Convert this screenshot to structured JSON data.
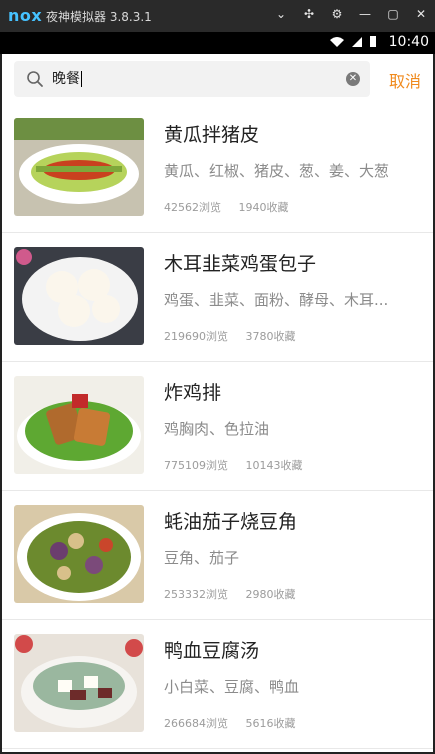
{
  "emulator": {
    "logo": "nox",
    "title": "夜神模拟器 3.8.3.1"
  },
  "status": {
    "time": "10:40"
  },
  "search": {
    "value": "晚餐",
    "cancel_label": "取消"
  },
  "recipes": [
    {
      "title": "黄瓜拌猪皮",
      "ingredients": "黄瓜、红椒、猪皮、葱、姜、大葱",
      "views": "42562浏览",
      "favorites": "1940收藏"
    },
    {
      "title": "木耳韭菜鸡蛋包子",
      "ingredients": "鸡蛋、韭菜、面粉、酵母、木耳...",
      "views": "219690浏览",
      "favorites": "3780收藏"
    },
    {
      "title": "炸鸡排",
      "ingredients": "鸡胸肉、色拉油",
      "views": "775109浏览",
      "favorites": "10143收藏"
    },
    {
      "title": "蚝油茄子烧豆角",
      "ingredients": "豆角、茄子",
      "views": "253332浏览",
      "favorites": "2980收藏"
    },
    {
      "title": "鸭血豆腐汤",
      "ingredients": "小白菜、豆腐、鸭血",
      "views": "266684浏览",
      "favorites": "5616收藏"
    }
  ]
}
